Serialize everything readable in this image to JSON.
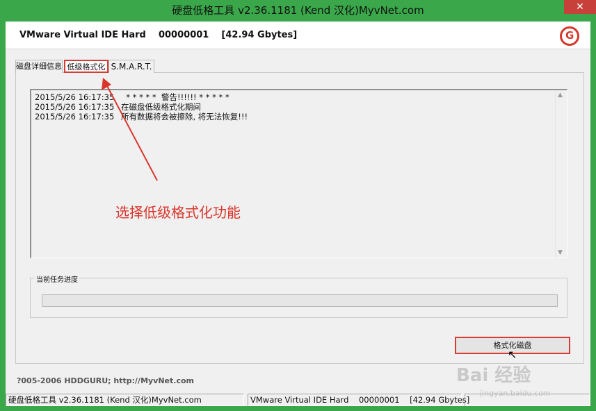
{
  "window": {
    "title": "硬盘低格工具 v2.36.1181 (Kend 汉化)MyvNet.com",
    "close_glyph": "✕"
  },
  "header": {
    "drive_info": "VMware Virtual IDE Hard    00000001    [42.94 Gbytes]",
    "logo_icon": "hddguru-logo-icon"
  },
  "tabs": [
    {
      "label": "磁盘详细信息"
    },
    {
      "label": "低级格式化"
    },
    {
      "label": "S.M.A.R.T."
    }
  ],
  "log": {
    "lines": [
      {
        "time": "2015/5/26 16:17:35",
        "message": "  * * * * *  警告!!!!!! * * * * *"
      },
      {
        "time": "2015/5/26 16:17:35",
        "message": "在磁盘低级格式化期间"
      },
      {
        "time": "2015/5/26 16:17:35",
        "message": "所有数据将会被擦除, 将无法恢复!!!"
      }
    ]
  },
  "progress": {
    "legend": "当前任务进度",
    "fraction": 0
  },
  "format_button": {
    "label": "格式化磁盘"
  },
  "copyright": "?005-2006 HDDGURU;    http://MyvNet.com",
  "statusbar": {
    "app": "硬盘低格工具 v2.36.1181 (Kend 汉化)MyvNet.com",
    "drive": "VMware Virtual IDE Hard    00000001    [42.94 Gbytes]",
    "extra": ""
  },
  "annotation": {
    "text": "选择低级格式化功能"
  },
  "watermark": {
    "text": "Bai 经验",
    "sub": "jingyan.baidu.com"
  },
  "colors": {
    "titlebar": "#3aa84a",
    "highlight": "#d93a32",
    "annotation": "#d9362b"
  }
}
